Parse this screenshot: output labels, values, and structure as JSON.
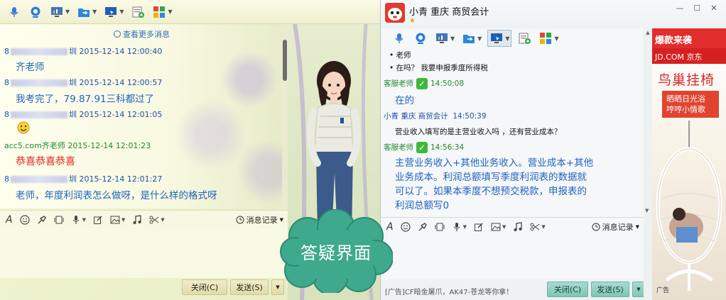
{
  "left": {
    "more_messages": "查看更多消息",
    "messages": [
      {
        "head": "8",
        "head_tail": "圳 2015-12-14 12:00:40",
        "body": "齐老师",
        "type": "user"
      },
      {
        "head": "8",
        "head_tail": "圳 2015-12-14 12:00:57",
        "body": "我考完了，79.87.91三科都过了",
        "type": "user"
      },
      {
        "head": "8",
        "head_tail": "圳 2015-12-14 12:01:05",
        "body": "",
        "type": "user",
        "emoji": "smile-emoji"
      },
      {
        "head": "acc5.com齐老师 2015-12-14 12:01:23",
        "head_tail": "",
        "body": "恭喜恭喜恭喜",
        "type": "teacher"
      },
      {
        "head": "8",
        "head_tail": "圳 2015-12-14 12:01:27",
        "body": "老师，年度利润表怎么做呀，是什么样的格式呀",
        "type": "user"
      }
    ],
    "history_label": "消息记录",
    "close_label": "关闭(C)",
    "send_label": "发送(S)"
  },
  "right": {
    "contact_name": "小青 重庆 商贸会计",
    "messages": [
      {
        "kind": "plain",
        "text": "老师"
      },
      {
        "kind": "plain",
        "text": "在吗？ 我要申报季度所得税"
      },
      {
        "kind": "head",
        "sender": "客服老师",
        "time": "14:50:08"
      },
      {
        "kind": "body",
        "text": "在的"
      },
      {
        "kind": "head",
        "sender": "小青 重庆 商贸会计",
        "time": "14:50:39"
      },
      {
        "kind": "plain",
        "text": "营业收入填写的是主营业收入吗 ，还有营业成本？"
      },
      {
        "kind": "head",
        "sender": "客服老师",
        "time": "14:56:34"
      },
      {
        "kind": "body",
        "lines": [
          "主营业务收入+其他业务收入。营业成本+其他",
          "业务成本。利润总额填写季度利润表的数据就",
          "可以了。如果本季度不想预交税款，申报表的",
          "利润总额写0"
        ]
      }
    ],
    "history_label": "消息记录",
    "ad_text": "[广告]CF暗金屠爪，AK47-苍龙等你拿！",
    "close_label": "关闭(C)",
    "send_label": "发送(S)"
  },
  "ad": {
    "top": "爆款来袭",
    "brand": "JD.COM 京东",
    "title": "鸟巢挂椅",
    "sub1": "晒晒日光浴",
    "sub2": "哼哼小情歌",
    "label": "广告"
  },
  "badge": {
    "text": "答疑界面",
    "color": "#3fa98d"
  },
  "colors": {
    "accent_blue": "#1e63c4",
    "teacher_green": "#22892a",
    "red": "#e0261c"
  }
}
